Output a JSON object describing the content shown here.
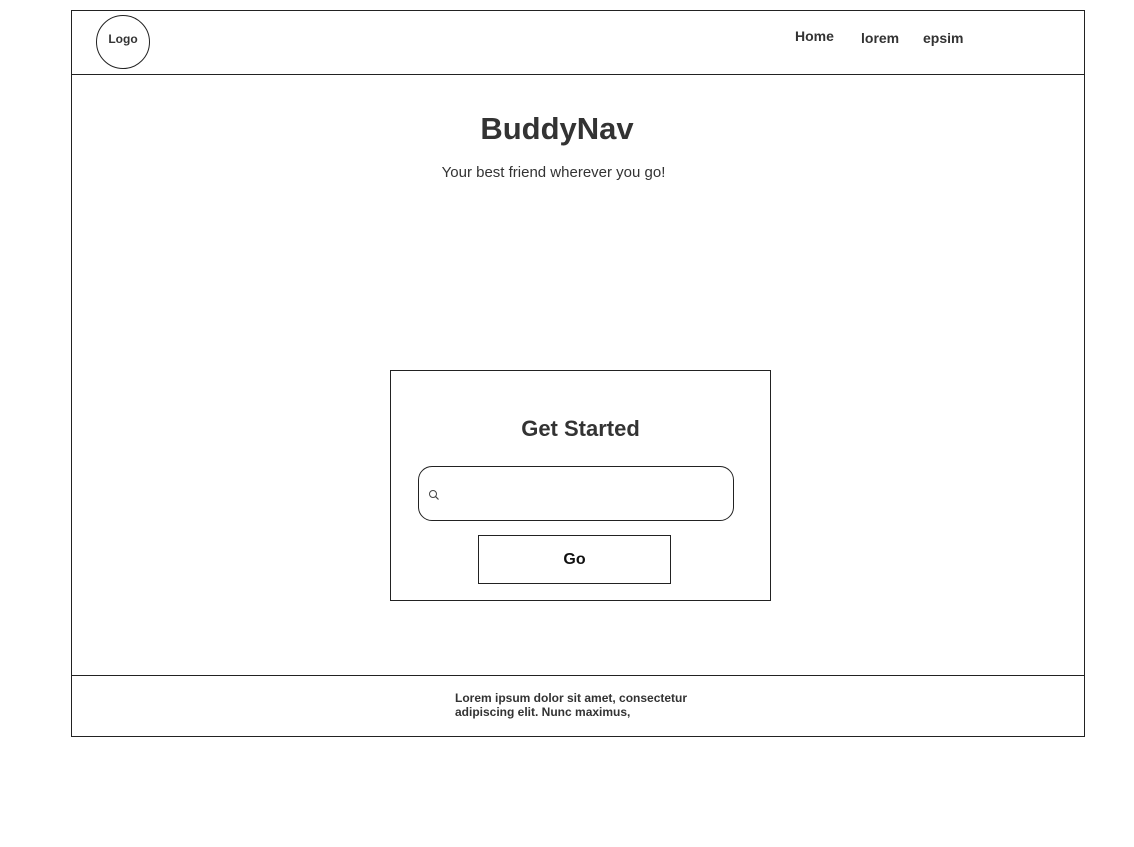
{
  "header": {
    "logo_label": "Logo",
    "nav": {
      "home": "Home",
      "lorem": "lorem",
      "epsim": "epsim"
    }
  },
  "hero": {
    "title": "BuddyNav",
    "subtitle": "Your best friend wherever you go!"
  },
  "card": {
    "title": "Get Started",
    "search": {
      "value": "",
      "placeholder": ""
    },
    "go_label": "Go"
  },
  "footer": {
    "text": "Lorem ipsum dolor sit amet, consectetur adipiscing elit. Nunc maximus,"
  },
  "icons": {
    "search": "search-icon"
  },
  "colors": {
    "border": "#222222",
    "text": "#333333",
    "background": "#ffffff"
  }
}
